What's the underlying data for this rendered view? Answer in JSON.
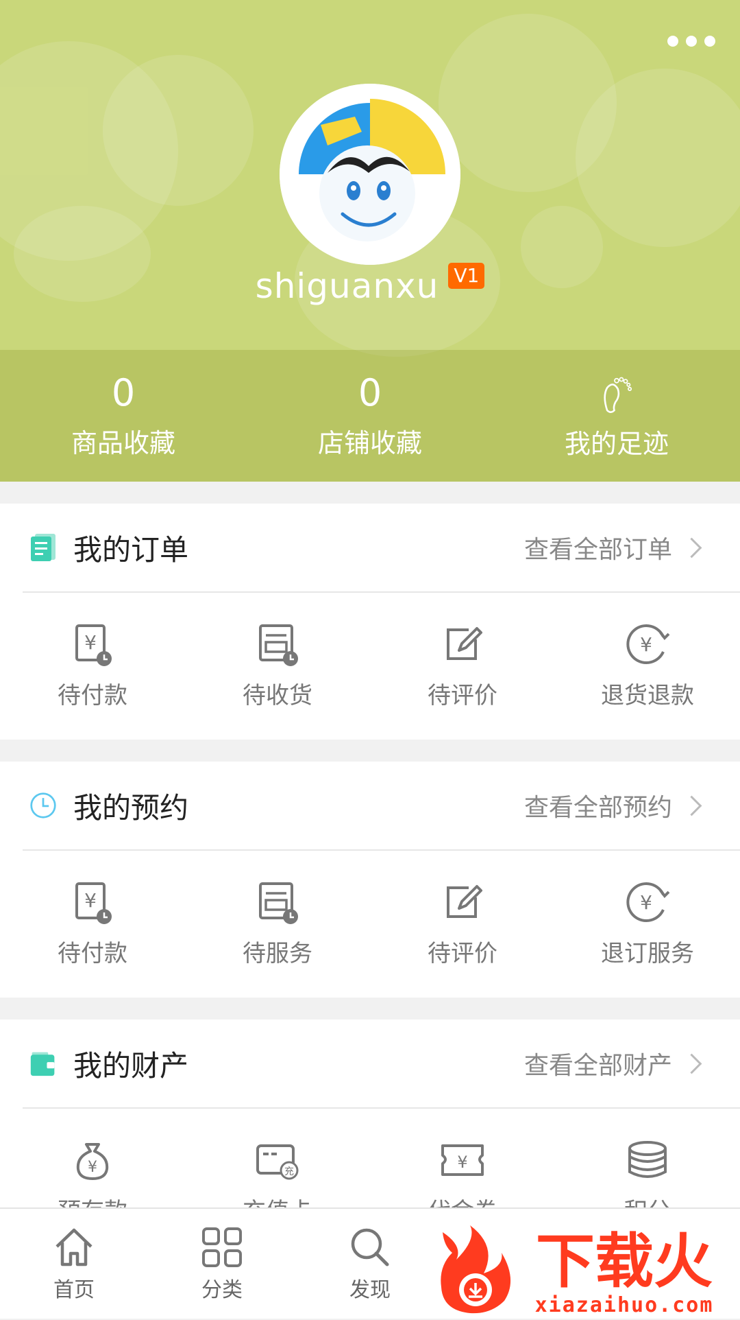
{
  "header": {
    "username": "shiguanxu",
    "level_badge": "V1",
    "stats": [
      {
        "value": "0",
        "label": "商品收藏"
      },
      {
        "value": "0",
        "label": "店铺收藏"
      },
      {
        "label": "我的足迹",
        "icon": "footprint-icon"
      }
    ]
  },
  "orders": {
    "title": "我的订单",
    "link": "查看全部订单",
    "items": [
      "待付款",
      "待收货",
      "待评价",
      "退货退款"
    ]
  },
  "reservations": {
    "title": "我的预约",
    "link": "查看全部预约",
    "items": [
      "待付款",
      "待服务",
      "待评价",
      "退订服务"
    ]
  },
  "assets": {
    "title": "我的财产",
    "link": "查看全部财产",
    "items": [
      "预存款",
      "充值卡",
      "代金券",
      "积分"
    ]
  },
  "tabbar": [
    "首页",
    "分类",
    "发现"
  ],
  "watermark": {
    "brand": "下载火",
    "domain": "xiazaihuo.com"
  },
  "colors": {
    "header_bg": "#c9d77a",
    "badge": "#ff6a00",
    "accent_teal": "#3ecfb2",
    "watermark_red": "#ff3b1f"
  }
}
